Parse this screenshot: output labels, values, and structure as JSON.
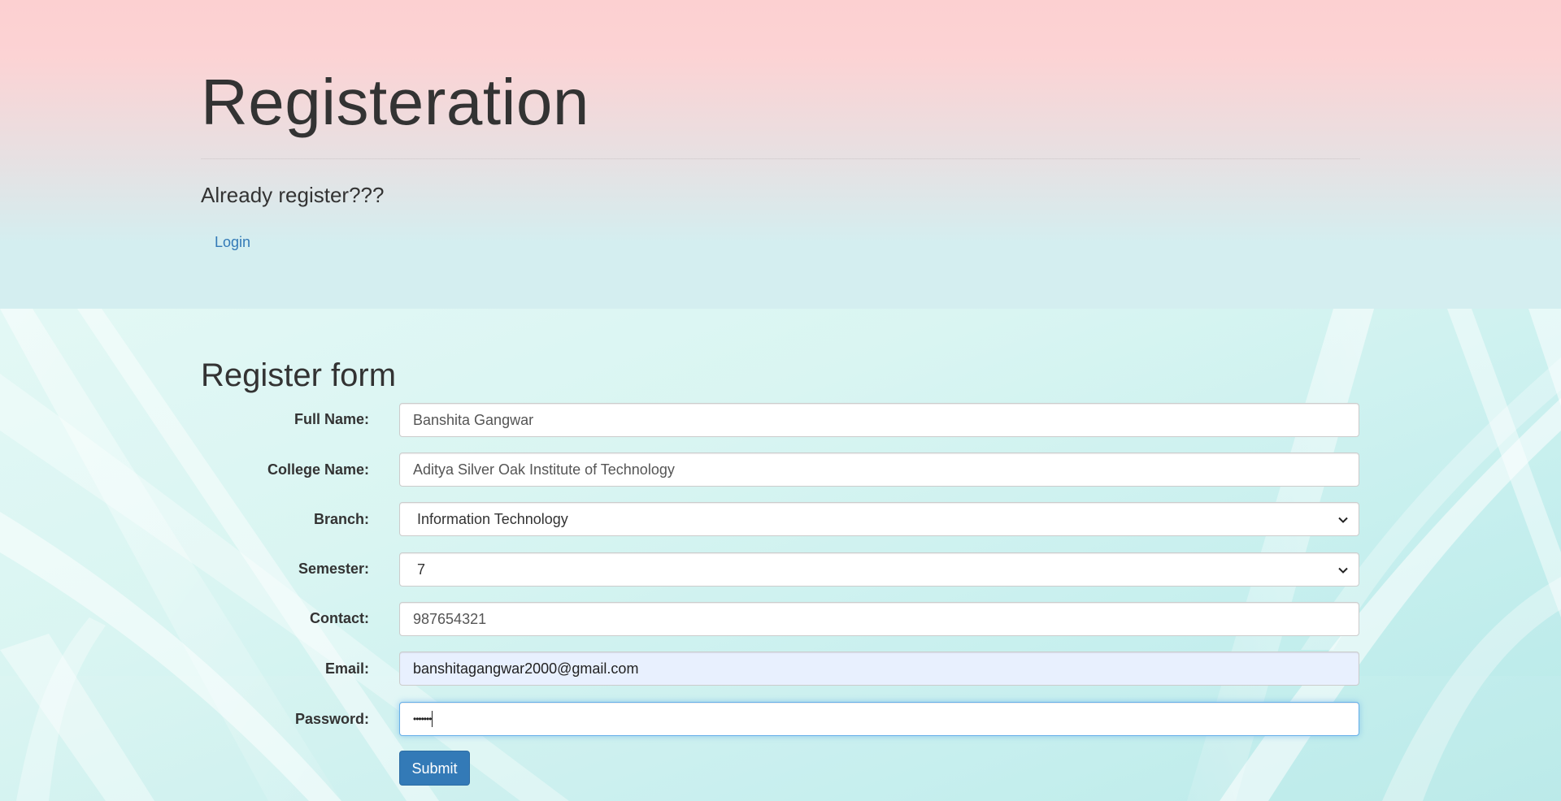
{
  "header": {
    "title": "Registeration",
    "already_text": "Already register???",
    "login_link": "Login"
  },
  "form": {
    "title": "Register form",
    "fields": {
      "full_name": {
        "label": "Full Name:",
        "value": "Banshita Gangwar"
      },
      "college_name": {
        "label": "College Name:",
        "value": "Aditya Silver Oak Institute of Technology"
      },
      "branch": {
        "label": "Branch:",
        "value": "Information Technology"
      },
      "semester": {
        "label": "Semester:",
        "value": "7"
      },
      "contact": {
        "label": "Contact:",
        "value": "987654321"
      },
      "email": {
        "label": "Email:",
        "value": "banshitagangwar2000@gmail.com"
      },
      "password": {
        "label": "Password:",
        "value": "•••••••"
      }
    },
    "submit_label": "Submit"
  },
  "colors": {
    "link": "#337ab7",
    "button": "#337ab7",
    "autofill": "#e8f0fe",
    "focus": "#66afe9"
  }
}
